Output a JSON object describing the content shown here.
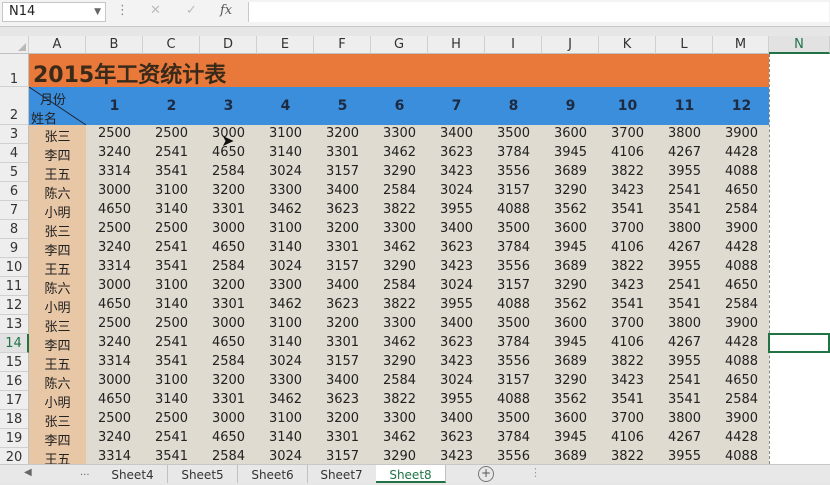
{
  "name_box": "N14",
  "formula_bar": {
    "cancel_icon": "✕",
    "enter_icon": "✓",
    "fx_label": "fx"
  },
  "columns": [
    "A",
    "B",
    "C",
    "D",
    "E",
    "F",
    "G",
    "H",
    "I",
    "J",
    "K",
    "L",
    "M",
    "N"
  ],
  "rows": [
    "1",
    "2",
    "3",
    "4",
    "5",
    "6",
    "7",
    "8",
    "9",
    "10",
    "11",
    "12",
    "13",
    "14",
    "15",
    "16",
    "17",
    "18",
    "19",
    "20"
  ],
  "selected_column": "N",
  "selected_row": "14",
  "title": "2015年工资统计表",
  "header": {
    "month_label": "月份",
    "name_label": "姓名"
  },
  "months": [
    "1",
    "2",
    "3",
    "4",
    "5",
    "6",
    "7",
    "8",
    "9",
    "10",
    "11",
    "12"
  ],
  "names": [
    "张三",
    "李四",
    "王五",
    "陈六",
    "小明",
    "张三",
    "李四",
    "王五",
    "陈六",
    "小明",
    "张三",
    "李四",
    "王五",
    "陈六",
    "小明",
    "张三",
    "李四",
    "王五"
  ],
  "data": [
    [
      "2500",
      "2500",
      "3000",
      "3100",
      "3200",
      "3300",
      "3400",
      "3500",
      "3600",
      "3700",
      "3800",
      "3900"
    ],
    [
      "3240",
      "2541",
      "4650",
      "3140",
      "3301",
      "3462",
      "3623",
      "3784",
      "3945",
      "4106",
      "4267",
      "4428"
    ],
    [
      "3314",
      "3541",
      "2584",
      "3024",
      "3157",
      "3290",
      "3423",
      "3556",
      "3689",
      "3822",
      "3955",
      "4088"
    ],
    [
      "3000",
      "3100",
      "3200",
      "3300",
      "3400",
      "2584",
      "3024",
      "3157",
      "3290",
      "3423",
      "2541",
      "4650"
    ],
    [
      "4650",
      "3140",
      "3301",
      "3462",
      "3623",
      "3822",
      "3955",
      "4088",
      "3562",
      "3541",
      "3541",
      "2584"
    ],
    [
      "2500",
      "2500",
      "3000",
      "3100",
      "3200",
      "3300",
      "3400",
      "3500",
      "3600",
      "3700",
      "3800",
      "3900"
    ],
    [
      "3240",
      "2541",
      "4650",
      "3140",
      "3301",
      "3462",
      "3623",
      "3784",
      "3945",
      "4106",
      "4267",
      "4428"
    ],
    [
      "3314",
      "3541",
      "2584",
      "3024",
      "3157",
      "3290",
      "3423",
      "3556",
      "3689",
      "3822",
      "3955",
      "4088"
    ],
    [
      "3000",
      "3100",
      "3200",
      "3300",
      "3400",
      "2584",
      "3024",
      "3157",
      "3290",
      "3423",
      "2541",
      "4650"
    ],
    [
      "4650",
      "3140",
      "3301",
      "3462",
      "3623",
      "3822",
      "3955",
      "4088",
      "3562",
      "3541",
      "3541",
      "2584"
    ],
    [
      "2500",
      "2500",
      "3000",
      "3100",
      "3200",
      "3300",
      "3400",
      "3500",
      "3600",
      "3700",
      "3800",
      "3900"
    ],
    [
      "3240",
      "2541",
      "4650",
      "3140",
      "3301",
      "3462",
      "3623",
      "3784",
      "3945",
      "4106",
      "4267",
      "4428"
    ],
    [
      "3314",
      "3541",
      "2584",
      "3024",
      "3157",
      "3290",
      "3423",
      "3556",
      "3689",
      "3822",
      "3955",
      "4088"
    ],
    [
      "3000",
      "3100",
      "3200",
      "3300",
      "3400",
      "2584",
      "3024",
      "3157",
      "3290",
      "3423",
      "2541",
      "4650"
    ],
    [
      "4650",
      "3140",
      "3301",
      "3462",
      "3623",
      "3822",
      "3955",
      "4088",
      "3562",
      "3541",
      "3541",
      "2584"
    ],
    [
      "2500",
      "2500",
      "3000",
      "3100",
      "3200",
      "3300",
      "3400",
      "3500",
      "3600",
      "3700",
      "3800",
      "3900"
    ],
    [
      "3240",
      "2541",
      "4650",
      "3140",
      "3301",
      "3462",
      "3623",
      "3784",
      "3945",
      "4106",
      "4267",
      "4428"
    ],
    [
      "3314",
      "3541",
      "2584",
      "3024",
      "3157",
      "3290",
      "3423",
      "3556",
      "3689",
      "3822",
      "3955",
      "4088"
    ]
  ],
  "sheet_tabs": [
    "Sheet4",
    "Sheet5",
    "Sheet6",
    "Sheet7",
    "Sheet8"
  ],
  "active_sheet": "Sheet8",
  "tab_nav": {
    "prev_icon": "◀",
    "more_label": "...",
    "add_icon": "+",
    "scroll_dots": "⋮"
  },
  "colors": {
    "title_band": "#e8793a",
    "month_band": "#3b8edc",
    "name_column": "#e8c7a6",
    "accent": "#217346"
  }
}
